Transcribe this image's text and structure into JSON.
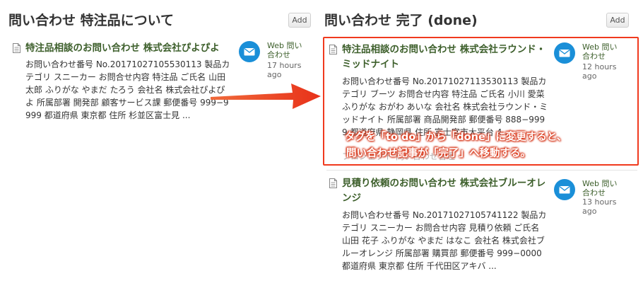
{
  "left_column": {
    "title": "問い合わせ 特注品について",
    "add_label": "Add",
    "cards": [
      {
        "title": "特注品相談のお問い合わせ 株式会社ぴよぴよ",
        "body": "お問い合わせ番号 No.20171027105530113 製品カテゴリ スニーカー お問合せ内容 特注品 ご氏名 山田 太郎 ふりがな やまだ たろう 会社名 株式会社ぴよぴよ 所属部署 開発部 顧客サービス課 郵便番号 999−9999 都道府県 東京都 住所 杉並区富士見 ...",
        "source": "Web 問い合わせ",
        "time": "17 hours ago",
        "icon": "document-icon",
        "avatar": "mail-icon"
      }
    ]
  },
  "right_column": {
    "title": "問い合わせ 完了 (done)",
    "add_label": "Add",
    "cards": [
      {
        "title": "特注品相談のお問い合わせ 株式会社ラウンド・ミッドナイト",
        "body": "お問い合わせ番号 No.20171027113530113 製品カテゴリ ブーツ お問合せ内容 特注品 ご氏名 小川 愛菜 ふりがな おがわ あいな 会社名 株式会社ラウンド・ミッドナイト 所属部署 商品開発部 郵便番号 888−9999 都道府県 静岡県 住所 富士宮市大平台 4 ...",
        "footer": "プロジェクト 問い合わせ管理",
        "source": "Web 問い合わせ",
        "time": "12 hours ago",
        "icon": "document-icon",
        "avatar": "mail-icon"
      },
      {
        "title": "見積り依頼のお問い合わせ 株式会社ブルーオレンジ",
        "body": "お問い合わせ番号 No.20171027105741122 製品カテゴリ スニーカー お問合せ内容 見積り依頼 ご氏名 山田 花子 ふりがな やまだ はなこ 会社名 株式会社ブルーオレンジ 所属部署 購買部 郵便番号 999−0000 都道府県 東京都 住所 千代田区アキバ ...",
        "source": "Web 問い合わせ",
        "time": "13 hours ago",
        "icon": "document-icon",
        "avatar": "mail-icon"
      }
    ]
  },
  "annotation": {
    "line1": "タグを「to do」から「done」に変更すると、",
    "line2": "問い合わせ記事が「完了」へ移動する。"
  },
  "colors": {
    "title_green": "#3d5f2b",
    "mail_blue": "#1a8fd8",
    "highlight_red": "#f03a1e"
  }
}
